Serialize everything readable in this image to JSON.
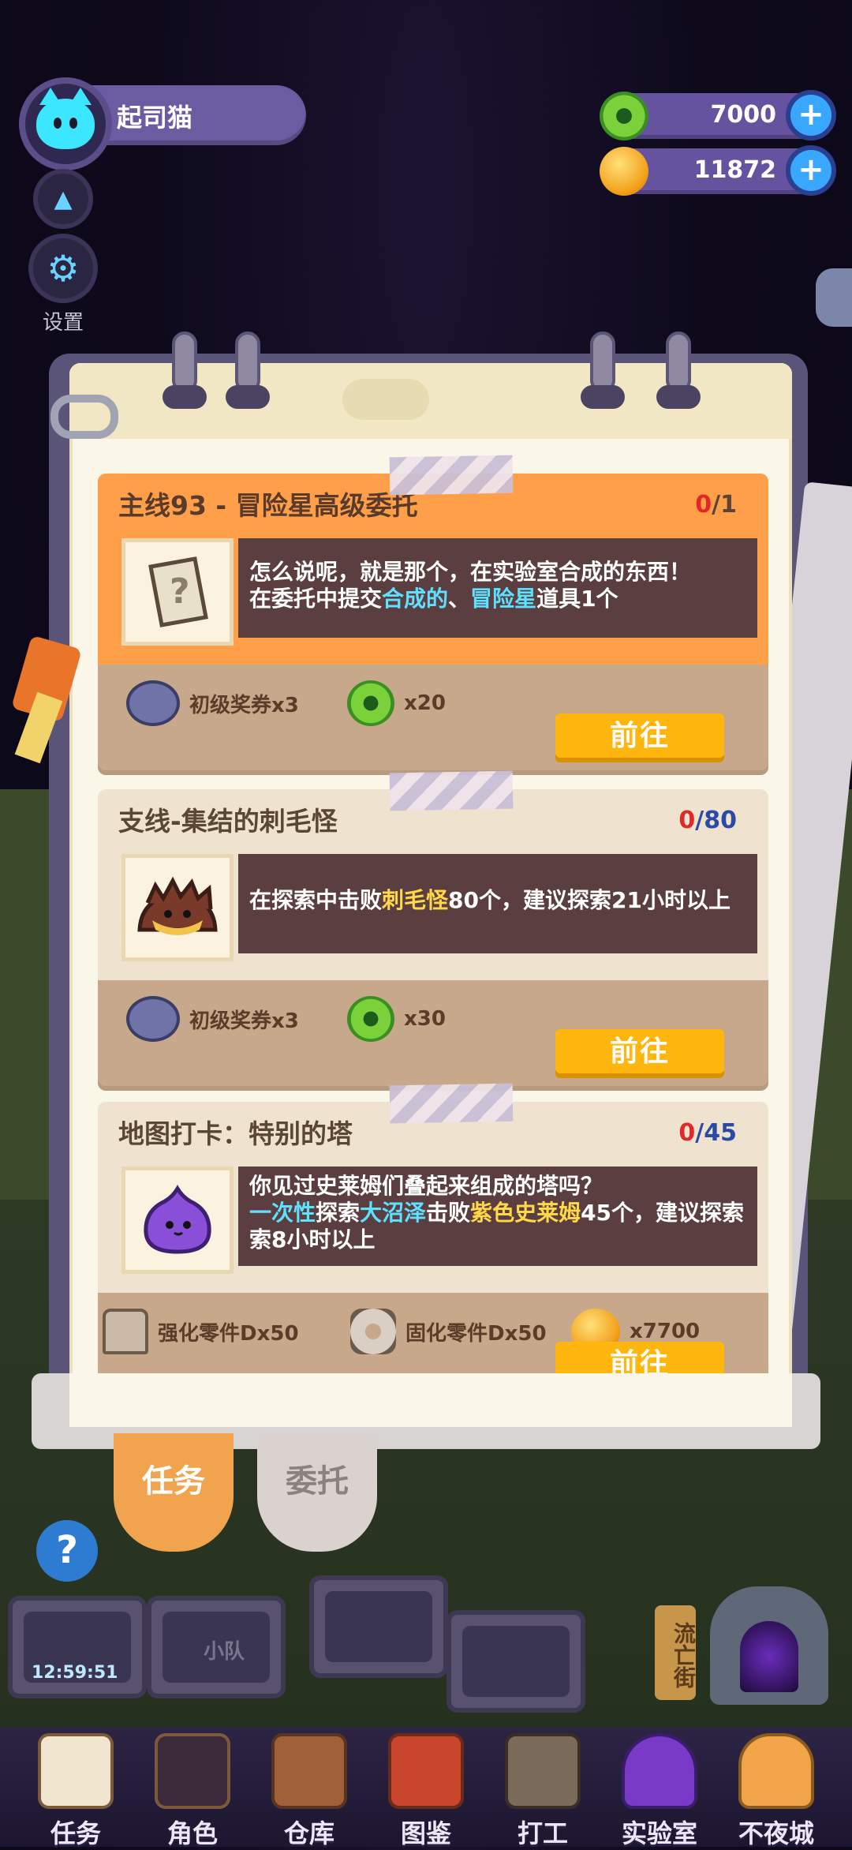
{
  "header": {
    "username": "起司猫",
    "currency_green": "7000",
    "currency_gold": "11872",
    "settings_label": "设置"
  },
  "quests": [
    {
      "title": "主线93 - 冒险星高级委托",
      "progress_current": "0",
      "progress_total": "/1",
      "desc_line1": "怎么说呢，就是那个，在实验室合成的东西！",
      "desc_line2_a": "在委托中提交",
      "desc_line2_b": "合成的",
      "desc_line2_c": "、",
      "desc_line2_d": "冒险星",
      "desc_line2_e": "道具1个",
      "reward1": "初级奖券x3",
      "reward2": "x20",
      "button": "前往"
    },
    {
      "title": "支线-集结的刺毛怪",
      "progress_current": "0",
      "progress_total": "/80",
      "desc_a": "在探索中击败",
      "desc_b": "刺毛怪",
      "desc_c": "80个，建议探索21小时以上",
      "reward1": "初级奖券x3",
      "reward2": "x30",
      "button": "前往"
    },
    {
      "title": "地图打卡：特别的塔",
      "progress_current": "0",
      "progress_total": "/45",
      "desc_line1": "你见过史莱姆们叠起来组成的塔吗？",
      "desc_a": "一次性",
      "desc_b": "探索",
      "desc_c": "大沼泽",
      "desc_d": "击败",
      "desc_e": "紫色史莱姆",
      "desc_f": "45个，建议探索",
      "desc_line3": "索8小时以上",
      "reward1": "强化零件Dx50",
      "reward2": "固化零件Dx50",
      "reward3": "x7700",
      "button": "前往"
    }
  ],
  "tabs": {
    "task": "任务",
    "commission": "委托"
  },
  "scene": {
    "timer": "12:59:51",
    "team": "小队",
    "sign": "流亡街"
  },
  "nav": [
    "任务",
    "角色",
    "仓库",
    "图鉴",
    "打工",
    "实验室",
    "不夜城"
  ],
  "colors": {
    "accent_orange": "#ff9f4a",
    "button_yellow": "#ffb70f",
    "highlight_cyan": "#5ee0ff",
    "highlight_yellow": "#ffd84a",
    "progress_red": "#e02828"
  }
}
